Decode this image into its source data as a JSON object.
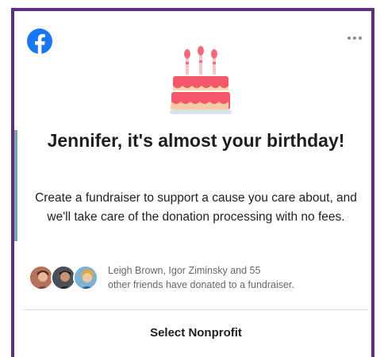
{
  "card": {
    "brand_color": "#1877f2",
    "frame_color": "#5e2f7a",
    "title": "Jennifer, it's almost your birthday!",
    "description": "Create a fundraiser to support a cause you care about, and we'll take care of the donation processing with no fees.",
    "friends_line1": "Leigh Brown, Igor Ziminsky and 55",
    "friends_line2": "other friends have donated to a fundraiser.",
    "cta_label": "Select Nonprofit"
  },
  "icons": {
    "logo": "facebook-logo-icon",
    "menu": "more-options-icon",
    "illustration": "birthday-cake-icon"
  },
  "avatars": [
    "friend-avatar-1",
    "friend-avatar-2",
    "friend-avatar-3"
  ]
}
